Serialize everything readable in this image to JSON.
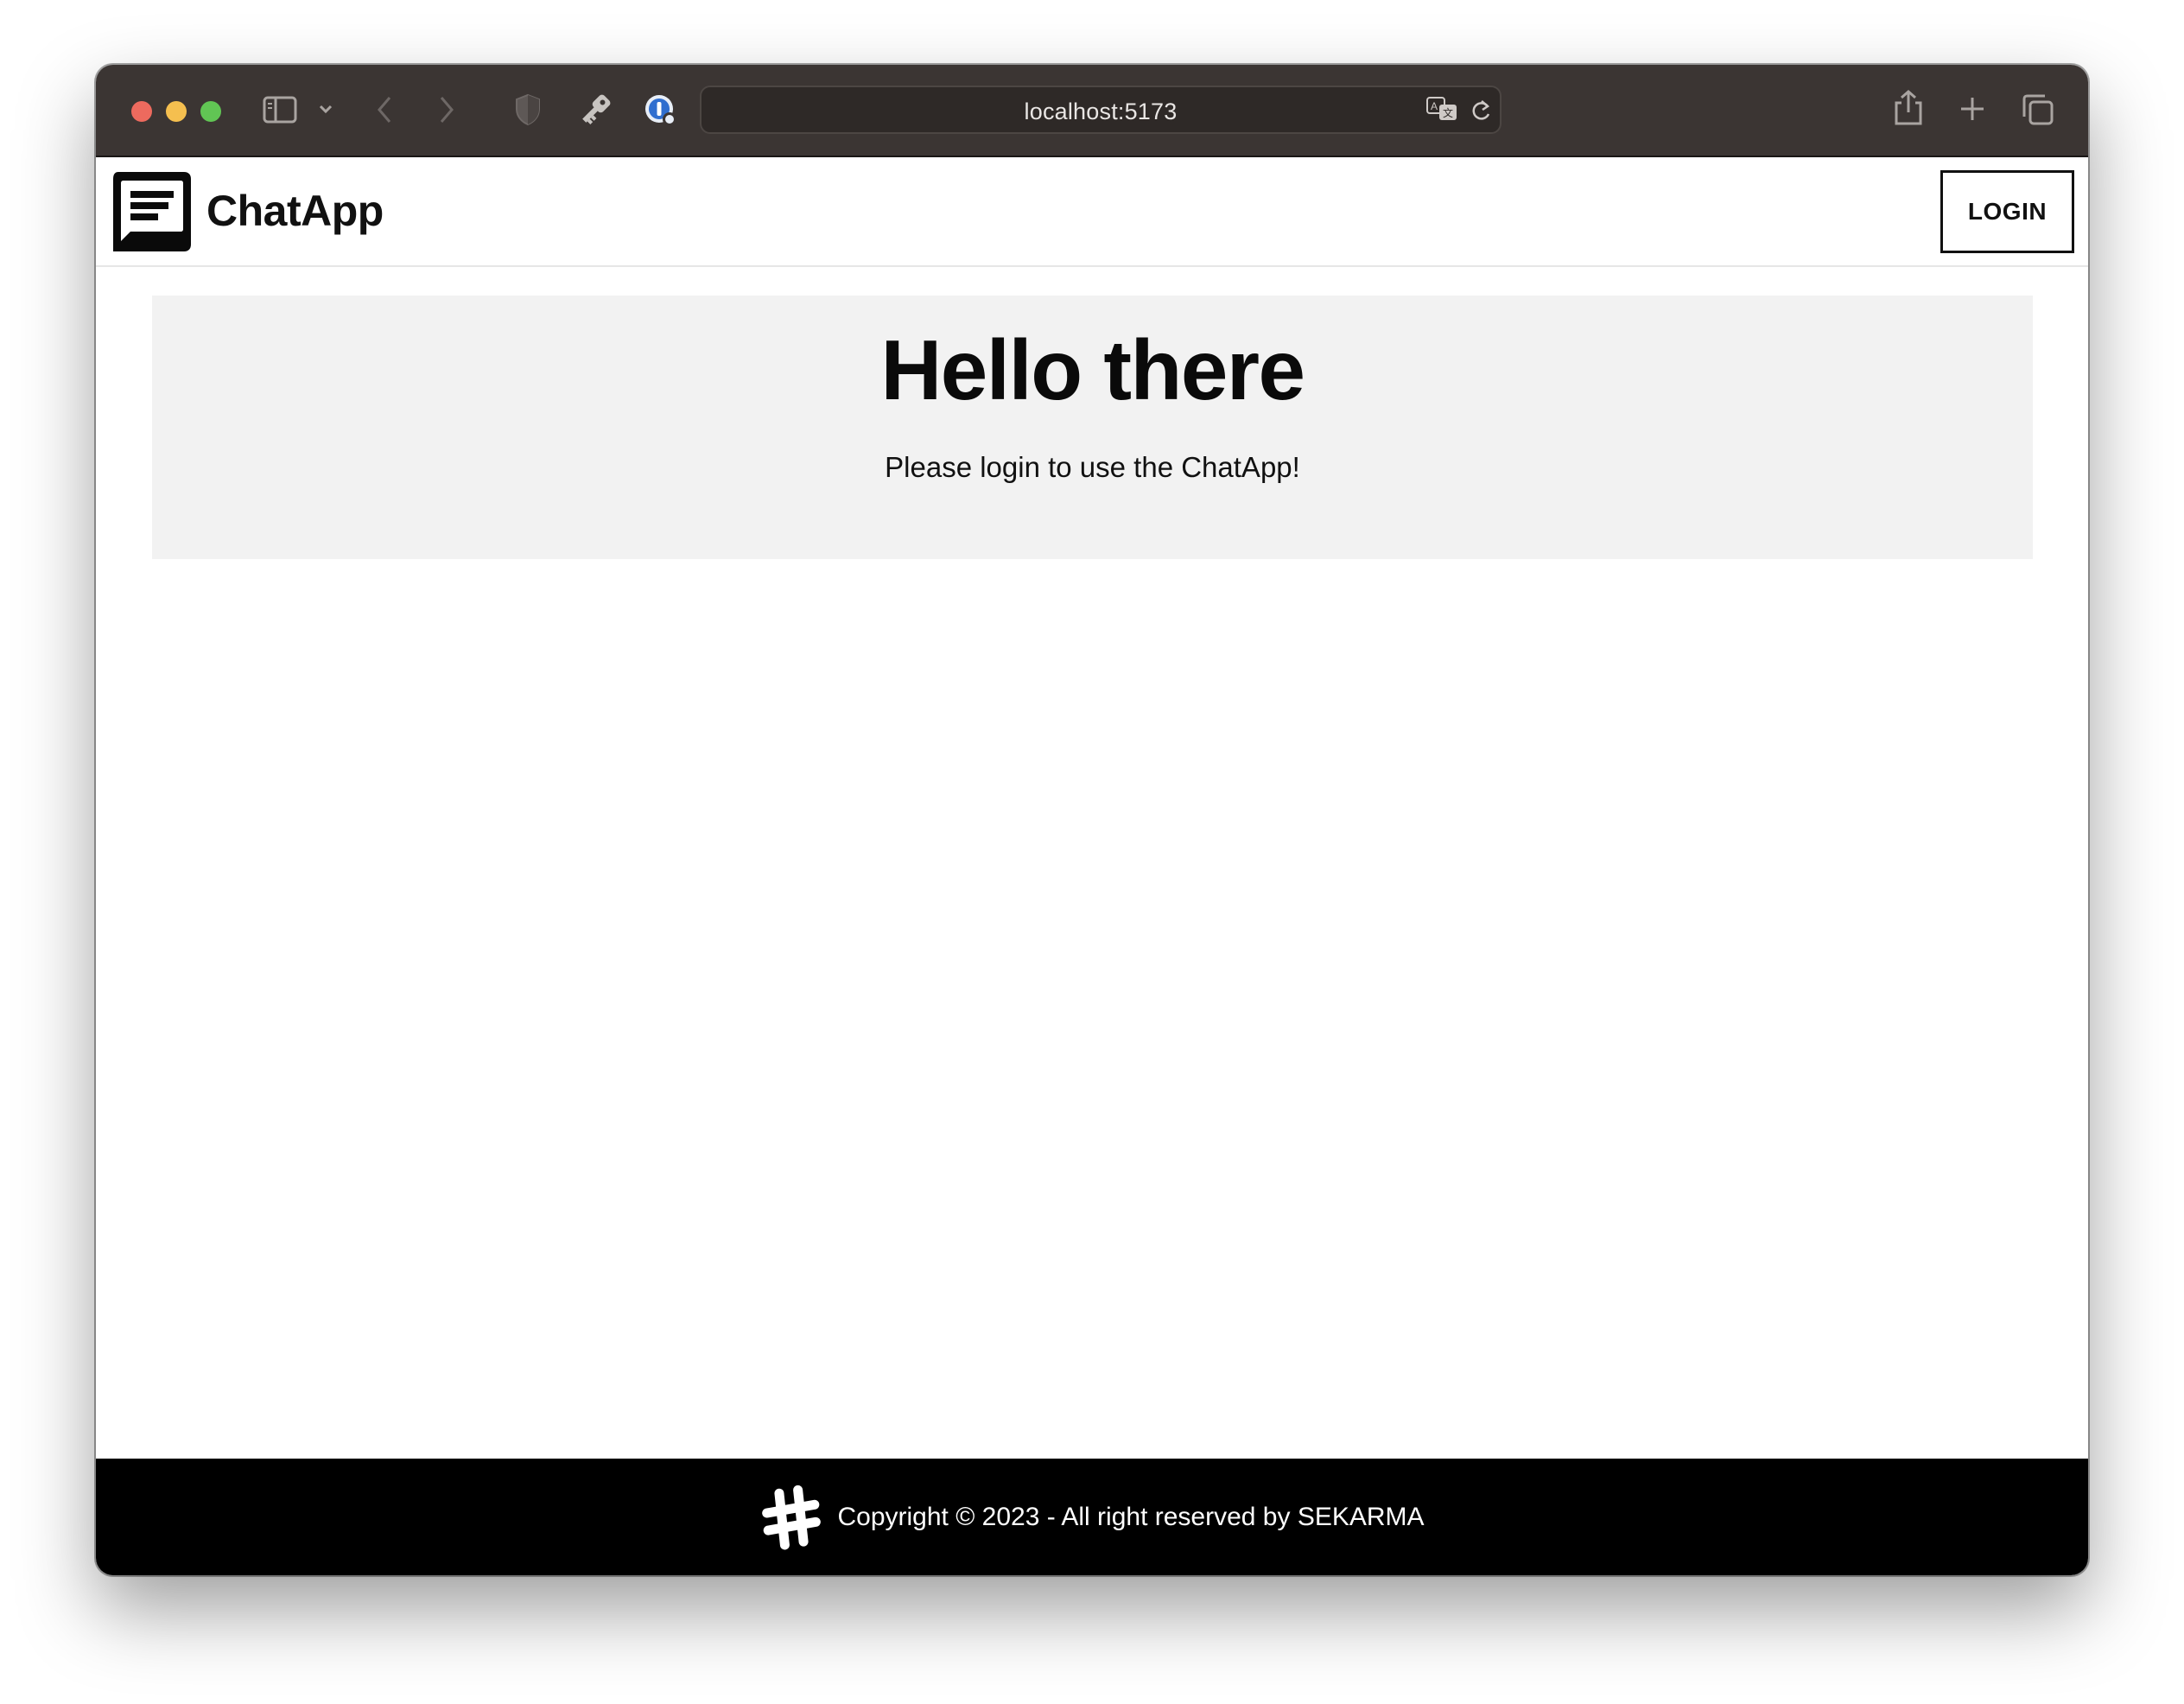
{
  "browser": {
    "url": "localhost:5173",
    "traffic_colors": {
      "close": "#ed6a5e",
      "minimize": "#f5bf4f",
      "zoom": "#61c554"
    }
  },
  "navbar": {
    "brand": "ChatApp",
    "login_label": "LOGIN"
  },
  "hero": {
    "title": "Hello there",
    "subtitle": "Please login to use the ChatApp!"
  },
  "footer": {
    "text": "Copyright © 2023 - All right reserved by SEKARMA"
  }
}
